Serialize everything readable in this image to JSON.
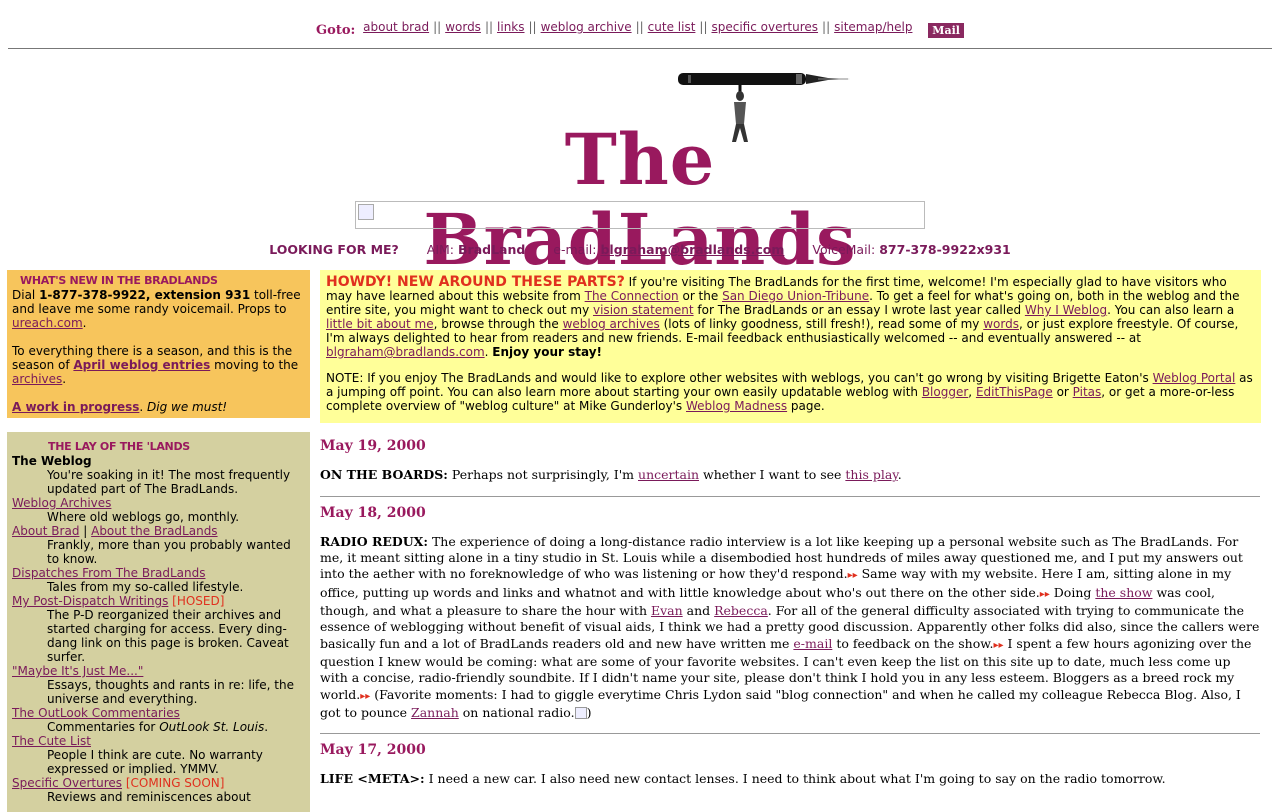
{
  "nav": {
    "goto": "Goto:",
    "links": [
      "about brad",
      "words",
      "links",
      "weblog archive",
      "cute list",
      "specific overtures",
      "sitemap/help"
    ],
    "separator": "||",
    "mail": "Mail"
  },
  "header": {
    "title": "The BradLands"
  },
  "contact": {
    "looking": "LOOKING FOR ME?",
    "aim_label": "AIM:",
    "aim": "BradLand",
    "email_label": "e-mail:",
    "email": "blgraham@bradlands.com",
    "voicemail_label": "VoiceMail:",
    "voicemail": "877-378-9922x931"
  },
  "whatsnew": {
    "heading": "What's New In The BradLands",
    "p1_a": "Dial ",
    "p1_bold": "1-877-378-9922, extension 931",
    "p1_b": " toll-free and leave me some randy voicemail. Props to ",
    "p1_link": "ureach.com",
    "p1_c": ".",
    "p2_a": "To everything there is a season, and this is the season of ",
    "p2_link": "April weblog entries",
    "p2_b": " moving to the ",
    "p2_link2": "archives",
    "p2_c": ".",
    "p3_link": "A work in progress",
    "p3_a": ". ",
    "p3_em": "Dig we must!"
  },
  "lay": {
    "heading": "The Lay Of The 'Lands",
    "weblog_title": "The Weblog",
    "weblog_desc": "You're soaking in it! The most frequently updated part of The BradLands.",
    "archives": "Weblog Archives",
    "archives_desc": "Where old weblogs go, monthly.",
    "about": "About Brad",
    "about_sep": " | ",
    "about2": "About the BradLands",
    "about_desc": "Frankly, more than you probably wanted to know.",
    "dispatches": "Dispatches From The BradLands",
    "dispatches_desc": "Tales from my so-called lifestyle.",
    "postdispatch": "My Post-Dispatch Writings",
    "postdispatch_tag": " [HOSED]",
    "postdispatch_desc": "The P-D reorganized their archives and started charging for access. Every ding-dang link on this page is broken. Caveat surfer.",
    "maybe": "\"Maybe It's Just Me...\"",
    "maybe_desc": "Essays, thoughts and rants in re: life, the universe and everything.",
    "outlook": "The OutLook Commentaries",
    "outlook_desc_a": "Commentaries for ",
    "outlook_desc_em": "OutLook St. Louis",
    "outlook_desc_b": ".",
    "cute": "The Cute List",
    "cute_desc": "People I think are cute. No warranty expressed or implied. YMMV.",
    "overtures": "Specific Overtures",
    "overtures_tag": " [COMING SOON]",
    "overtures_desc": "Reviews and reminiscences about"
  },
  "howdy": {
    "heading": "HOWDY! NEW AROUND THESE PARTS?",
    "t1": " If you're visiting The BradLands for the first time, welcome! I'm especially glad to have visitors who may have learned about this website from ",
    "l1": "The Connection",
    "t2": " or the ",
    "l2": "San Diego Union-Tribune",
    "t3": ". To get a feel for what's going on, both in the weblog and the entire site, you might want to check out my ",
    "l3": "vision statement",
    "t4": " for The BradLands or an essay I wrote last year called ",
    "l4": "Why I Weblog",
    "t5": ". You can also learn a ",
    "l5": "little bit about me",
    "t6": ", browse through the ",
    "l6": "weblog archives",
    "t7": " (lots of linky goodness, still fresh!), read some of my ",
    "l7": "words",
    "t8": ", or just explore freestyle. Of course, I'm always delighted to hear from readers and new friends. E-mail feedback enthusiastically welcomed -- and eventually answered -- at ",
    "l8": "blgraham@bradlands.com",
    "t9": ". ",
    "b9": "Enjoy your stay!",
    "n1": "NOTE: If you enjoy The BradLands and would like to explore other websites with weblogs, you can't go wrong by visiting Brigette Eaton's ",
    "nl1": "Weblog Portal",
    "n2": " as a jumping off point. You can also learn more about starting your own easily updatable weblog with ",
    "nl2": "Blogger",
    "n3": ", ",
    "nl3": "EditThisPage",
    "n4": " or ",
    "nl4": "Pitas",
    "n5": ", or get a more-or-less complete overview of \"weblog culture\" at Mike Gunderloy's ",
    "nl5": "Weblog Madness",
    "n6": " page."
  },
  "weblog": {
    "d1": "May 19, 2000",
    "e1_label": "ON THE BOARDS:",
    "e1_a": " Perhaps not surprisingly, I'm ",
    "e1_l1": "uncertain",
    "e1_b": " whether I want to see ",
    "e1_l2": "this play",
    "e1_c": ".",
    "d2": "May 18, 2000",
    "e2_label": "RADIO REDUX:",
    "e2_a": " The experience of doing a long-distance radio interview is a lot like keeping up a personal website such as The BradLands. For me, it meant sitting alone in a tiny studio in St. Louis while a disembodied host hundreds of miles away questioned me, and I put my answers out into the aether with no foreknowledge of who was listening or how they'd respond.",
    "e2_b": " Same way with my website. Here I am, sitting alone in my office, putting up words and links and whatnot and with little knowledge about who's out there on the other side.",
    "e2_c": " Doing ",
    "e2_l1": "the show",
    "e2_d": " was cool, though, and what a pleasure to share the hour with ",
    "e2_l2": "Evan",
    "e2_e": " and ",
    "e2_l3": "Rebecca",
    "e2_f": ". For all of the general difficulty associated with trying to communicate the essence of weblogging without benefit of visual aids, I think we had a pretty good discussion. Apparently other folks did also, since the callers were basically fun and a lot of BradLands readers old and new have written me ",
    "e2_l4": "e-mail",
    "e2_g": " to feedback on the show.",
    "e2_h": " I spent a few hours agonizing over the question I knew would be coming: what are some of your favorite websites. I can't even keep the list on this site up to date, much less come up with a concise, radio-friendly soundbite. If I didn't name your site, please don't think I hold you in any less esteem. Bloggers as a breed rock my world.",
    "e2_i": " (Favorite moments: I had to giggle everytime Chris Lydon said \"blog connection\" and when he called my colleague Rebecca Blog. Also, I got to pounce ",
    "e2_l5": "Zannah",
    "e2_j": " on national radio.",
    "e2_k": ")",
    "d3": "May 17, 2000",
    "e3_label": "LIFE <META>:",
    "e3_a": " I need a new car. I also need new contact lenses. I need to think about what I'm going to say on the radio tomorrow."
  },
  "icons": {
    "arrow": "double-arrow-icon",
    "smiley": "smiley-icon",
    "pen": "fountain-pen-icon",
    "broken_image": "broken-image-icon"
  }
}
